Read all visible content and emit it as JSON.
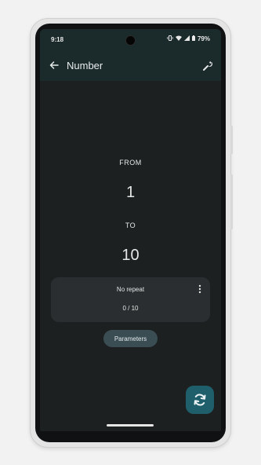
{
  "status_bar": {
    "time": "9:18",
    "battery": "79%"
  },
  "app_bar": {
    "title": "Number"
  },
  "range": {
    "from_label": "FROM",
    "from_value": "1",
    "to_label": "TO",
    "to_value": "10"
  },
  "repeat_card": {
    "title": "No repeat",
    "count": "0 / 10"
  },
  "parameters_button": {
    "label": "Parameters"
  },
  "colors": {
    "background": "#1d2021",
    "app_bar": "#1b2a2b",
    "card": "#2a2e30",
    "chip": "#3a4d53",
    "fab": "#1f5f6b"
  },
  "icons": {
    "back": "arrow-back-icon",
    "settings": "wrench-icon",
    "menu": "more-vert-icon",
    "refresh": "refresh-icon"
  }
}
